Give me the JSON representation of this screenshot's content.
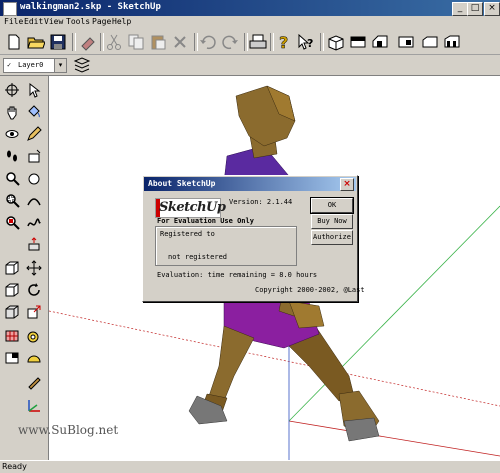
{
  "window": {
    "title": "walkingman2.skp - SketchUp"
  },
  "titlebar_buttons": {
    "minimize": "_",
    "maximize": "□",
    "close": "×"
  },
  "menu": [
    "File",
    "Edit",
    "View",
    "Tools",
    "Page",
    "Help"
  ],
  "toolbar": {
    "icons": [
      "new-file-icon",
      "open-folder-icon",
      "save-icon",
      "erase-icon",
      "cut-icon",
      "copy-icon",
      "paste-icon",
      "delete-icon",
      "undo-icon",
      "redo-icon",
      "print-icon",
      "help-icon",
      "context-help-icon",
      "iso-view-icon",
      "top-view-icon",
      "front-view-icon",
      "right-view-icon",
      "back-view-icon",
      "left-view-icon"
    ]
  },
  "layer_toolbar": {
    "current_layer": "Layer0",
    "check": "✓",
    "dropdown_arrow": "▾"
  },
  "dialog": {
    "title": "About SketchUp",
    "close_glyph": "×",
    "logo": "SketchUp",
    "version": "Version: 2.1.44",
    "eval_notice": "For Evaluation Use Only",
    "registered_to_label": "Registered to",
    "registered_status": "not registered",
    "evaluation_time": "Evaluation: time remaining = 8.0 hours",
    "copyright": "Copyright 2000-2002, @Last",
    "buttons": {
      "ok": "OK",
      "buy_now": "Buy Now",
      "authorize": "Authorize"
    }
  },
  "watermark": "www.SuBlog.net",
  "status": {
    "text": "Ready"
  },
  "colors": {
    "titlebar": "#0a246a",
    "figure_skin": "#8b6b2e",
    "figure_shirt": "#5a2aa0",
    "figure_pants": "#8b1fa0",
    "figure_shoes": "#7a7a7a",
    "axis_green": "#3cb44b",
    "axis_blue": "#3050c0",
    "axis_red": "#c02020"
  }
}
